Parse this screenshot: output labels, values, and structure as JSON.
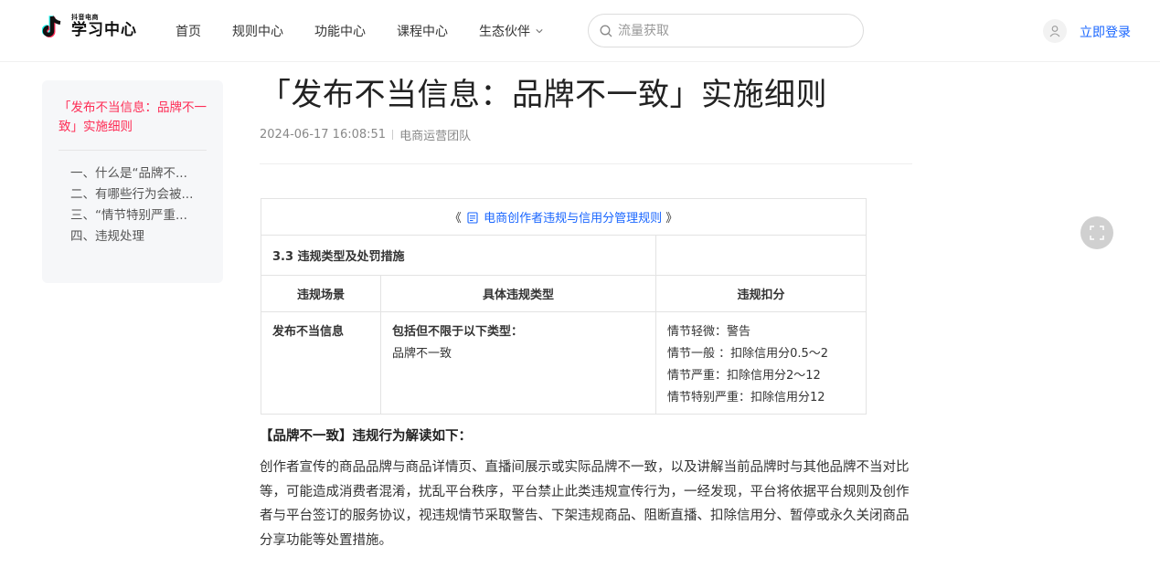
{
  "header": {
    "logo_small": "抖音电商",
    "logo_big": "学习中心",
    "nav": [
      "首页",
      "规则中心",
      "功能中心",
      "课程中心",
      "生态伙伴"
    ],
    "search_placeholder": "流量获取",
    "login_label": "立即登录"
  },
  "toc": {
    "title": "「发布不当信息：品牌不一致」实施细则",
    "items": [
      "一、什么是“品牌不...",
      "二、有哪些行为会被...",
      "三、“情节特别严重...",
      "四、违规处理"
    ]
  },
  "article": {
    "title": "「发布不当信息：品牌不一致」实施细则",
    "date": "2024-06-17 16:08:51",
    "author": "电商运营团队",
    "table": {
      "link_prefix": "《",
      "link_text": "电商创作者违规与信用分管理规则",
      "link_suffix": "》",
      "section": "3.3 违规类型及处罚措施",
      "headers": [
        "违规场景",
        "具体违规类型",
        "违规扣分"
      ],
      "scene": "发布不当信息",
      "type_title": "包括但不限于以下类型：",
      "type_item": "品牌不一致",
      "penalties": [
        "情节轻微：警告",
        "情节一般 ：扣除信用分0.5～2",
        "情节严重：扣除信用分2～12",
        "情节特别严重：扣除信用分12"
      ]
    },
    "subheading": "【品牌不一致】违规行为解读如下：",
    "paragraph": "创作者宣传的商品品牌与商品详情页、直播间展示或实际品牌不一致，以及讲解当前品牌时与其他品牌不当对比等，可能造成消费者混淆，扰乱平台秩序，平台禁止此类违规宣传行为，一经发现，平台将依据平台规则及创作者与平台签订的服务协议，视违规情节采取警告、下架违规商品、阻断直播、扣除信用分、暂停或永久关闭商品分享功能等处置措施。"
  },
  "colors": {
    "accent": "#fe2c55",
    "link": "#1966ff"
  }
}
